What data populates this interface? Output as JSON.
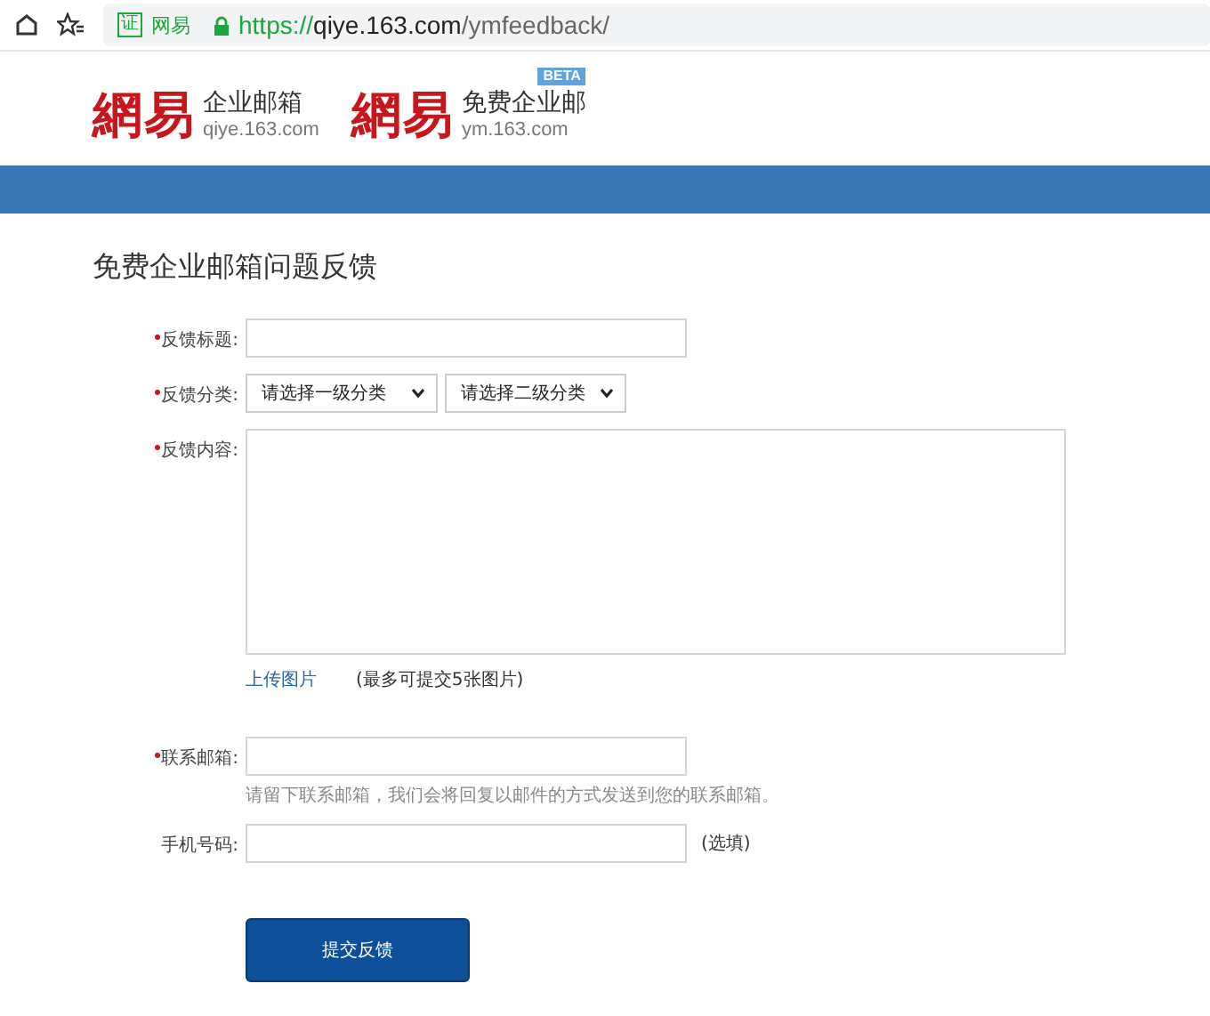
{
  "browser": {
    "cert_label": "证",
    "site_name": "网易",
    "url_scheme": "https://",
    "url_host": "qiye.163.com",
    "url_path": "/ymfeedback/"
  },
  "logos": [
    {
      "brand": "網易",
      "name": "企业邮箱",
      "domain": "qiye.163.com"
    },
    {
      "brand": "網易",
      "name": "免费企业邮",
      "domain": "ym.163.com",
      "badge": "BETA"
    }
  ],
  "page_title": "免费企业邮箱问题反馈",
  "form": [
    {
      "kind": "text",
      "label": "反馈标题:",
      "required": true
    },
    {
      "kind": "select",
      "label": "反馈分类:",
      "required": true,
      "options": [
        "请选择一级分类",
        "请选择二级分类"
      ]
    },
    {
      "kind": "textarea",
      "label": "反馈内容:",
      "required": true,
      "link": "上传图片",
      "note": "(最多可提交5张图片)"
    },
    {
      "kind": "text",
      "label": "联系邮箱:",
      "required": true,
      "hint": "请留下联系邮箱，我们会将回复以邮件的方式发送到您的联系邮箱。"
    },
    {
      "kind": "text",
      "label": "手机号码:",
      "required": false,
      "suffix": "(选填)"
    }
  ],
  "submit": "提交反馈"
}
